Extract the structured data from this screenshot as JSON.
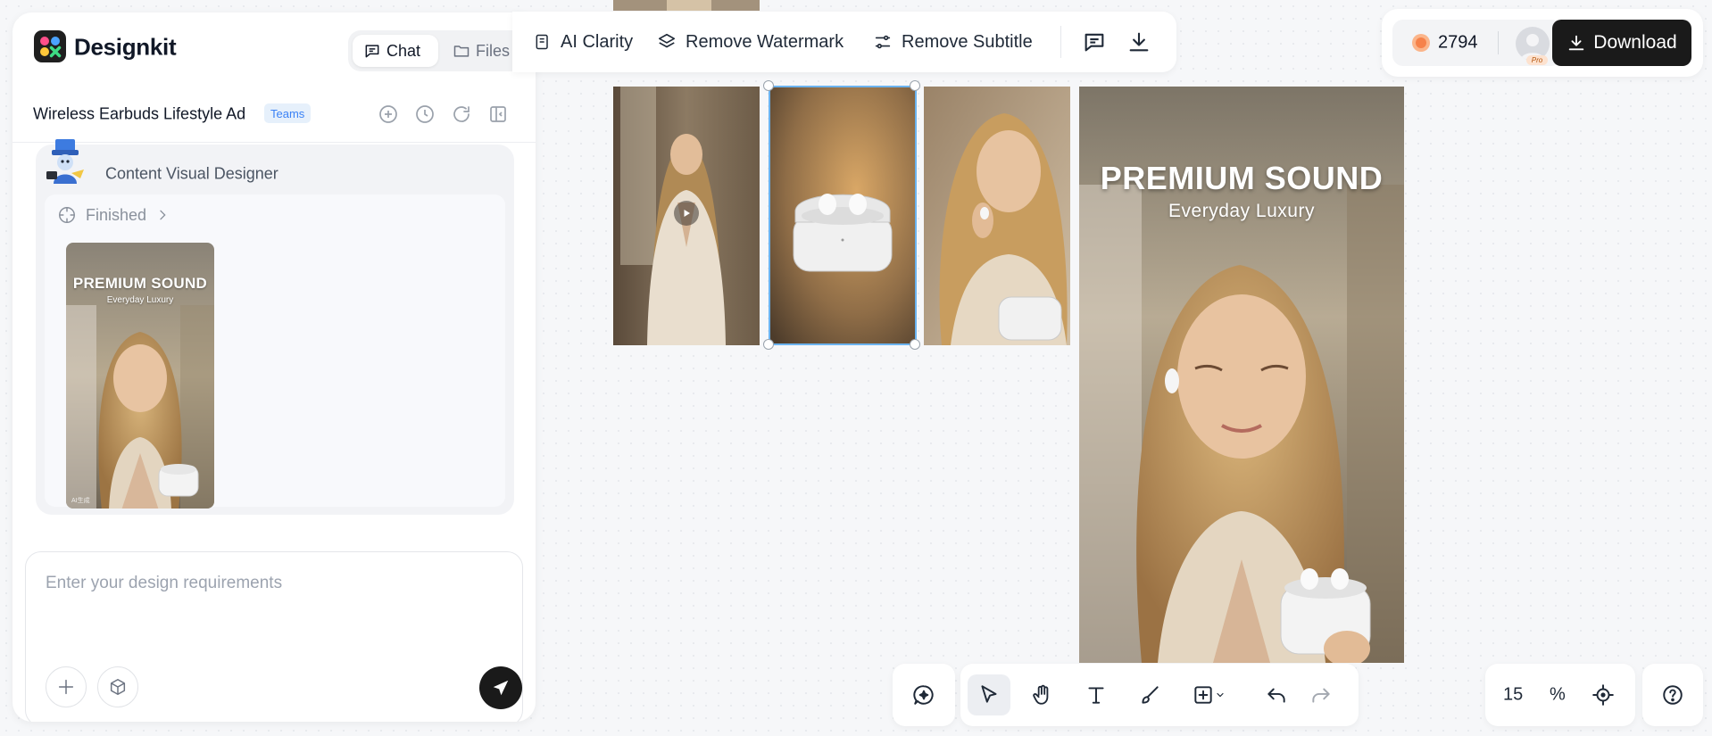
{
  "app": {
    "brand": "Designkit",
    "tabs": [
      {
        "label": "Chat",
        "icon": "chat-bubble-icon",
        "active": true
      },
      {
        "label": "Files",
        "icon": "folder-icon",
        "active": false
      }
    ]
  },
  "project": {
    "name": "Wireless Earbuds Lifestyle Ad",
    "badge": "Teams",
    "actions": [
      "add-icon",
      "history-icon",
      "refresh-icon",
      "collapse-panel-icon"
    ]
  },
  "agent": {
    "name": "Content Visual Designer",
    "status": "Finished",
    "thumbnail": {
      "title": "PREMIUM SOUND",
      "subtitle": "Everyday Luxury",
      "watermark": "AI生成"
    }
  },
  "composer": {
    "placeholder": "Enter your design requirements",
    "buttons": [
      "plus-icon",
      "cube-icon",
      "send-icon"
    ]
  },
  "toolbar": {
    "items": [
      {
        "label": "AI Clarity",
        "icon": "clarity-icon"
      },
      {
        "label": "Remove Watermark",
        "icon": "layers-icon"
      },
      {
        "label": "Remove Subtitle",
        "icon": "sliders-icon"
      }
    ],
    "icons": [
      "comment-icon",
      "download-icon"
    ]
  },
  "account": {
    "credits": "2794",
    "plan": "Pro",
    "download_label": "Download"
  },
  "canvas": {
    "poster": {
      "title": "PREMIUM SOUND",
      "subtitle": "Everyday Luxury"
    }
  },
  "bottom_tools": {
    "tools": [
      "ai-assist-icon",
      "select-cursor-icon",
      "hand-pan-icon",
      "text-tool-icon",
      "brush-icon",
      "add-shape-icon",
      "undo-icon",
      "redo-icon"
    ],
    "active_tool": "select-cursor-icon",
    "zoom": "15",
    "zoom_unit": "%"
  },
  "colors": {
    "accent_selection": "#6bb3ef",
    "primary_button": "#1a1a1a",
    "teams_badge_bg": "#e6f0fb",
    "teams_badge_text": "#3b82f6"
  }
}
